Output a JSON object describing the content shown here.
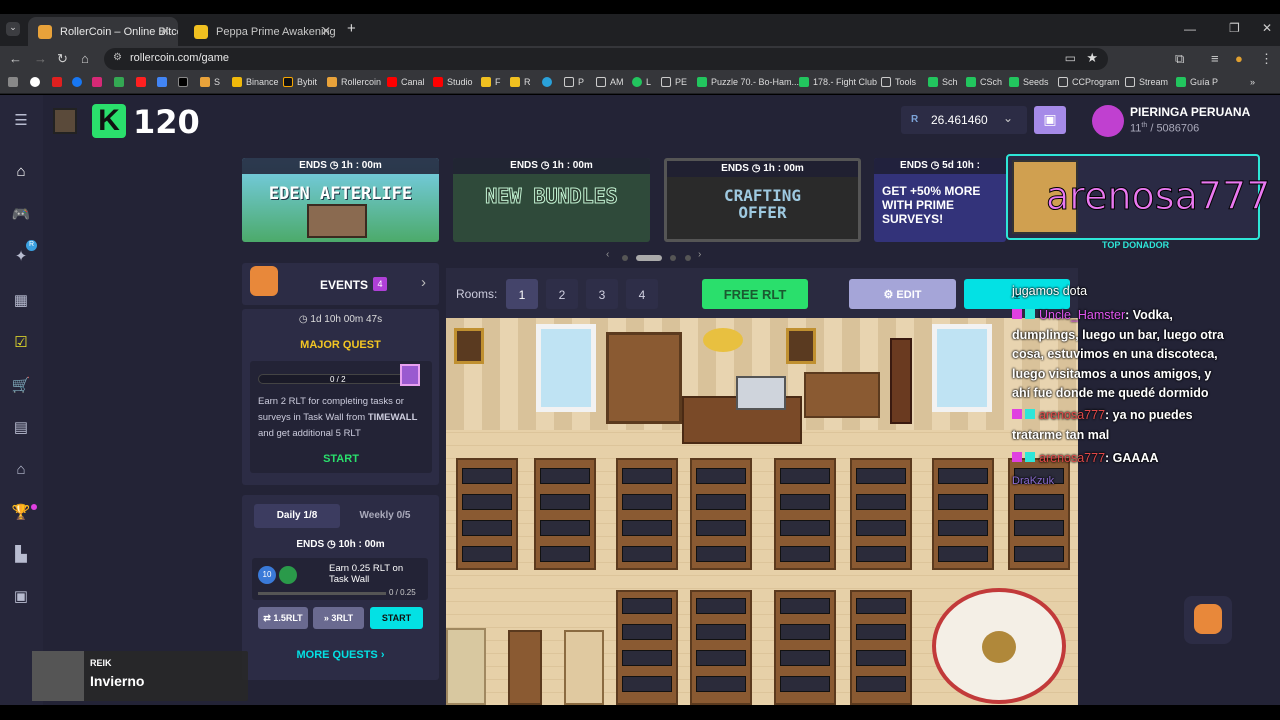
{
  "browser": {
    "tabs": [
      {
        "title": "RollerCoin – Online Bitcoin Min"
      },
      {
        "title": "Peppa Prime Awakening Event"
      }
    ],
    "new_tab": "+",
    "url": "rollercoin.com/game",
    "bookmarks": [
      "Binance",
      "Bybit",
      "Rollercoin",
      "Canal",
      "Studio",
      "F",
      "R",
      "P",
      "AM",
      "L",
      "PE",
      "Puzzle 70.- Bo-Ham...",
      "178.- Fight Club",
      "Tools",
      "Sch",
      "CSch",
      "Seeds",
      "CCProgram",
      "Stream",
      "Guía P",
      "S"
    ]
  },
  "header": {
    "level": "120",
    "balance": "26.461460",
    "balance_currency": "R",
    "username": "PIERINGA PERUANA",
    "rank": "11",
    "rank_suffix": "th",
    "rank_total": "/ 5086706"
  },
  "banners": [
    {
      "ends": "ENDS",
      "time": "1h : 00m",
      "title": "EDEN AFTERLIFE"
    },
    {
      "ends": "ENDS",
      "time": "1h : 00m",
      "title": "NEW BUNDLES"
    },
    {
      "ends": "ENDS",
      "time": "1h : 00m",
      "title": "CRAFTING OFFER"
    },
    {
      "ends": "ENDS",
      "time": "5d 10h :",
      "title": "GET +50% MORE WITH PRIME SURVEYS!"
    }
  ],
  "donor": {
    "name": "arenosa777",
    "label": "TOP DONADOR"
  },
  "events": {
    "title": "EVENTS",
    "count": "4",
    "timer": "1d 10h 00m 47s",
    "quest_title": "MAJOR QUEST",
    "progress": "0 / 2",
    "progress_fraction": 0,
    "description_1": "Earn 2 RLT for completing tasks or surveys in Task Wall from ",
    "description_strong": "TIMEWALL",
    "description_2": " and get additional 5 RLT",
    "start": "START"
  },
  "quests": {
    "daily": "Daily  1/8",
    "weekly": "Weekly  0/5",
    "ends": "ENDS",
    "ends_time": "10h : 00m",
    "task": "Earn 0.25 RLT on Task Wall",
    "task_progress": "0 / 0.25",
    "task_fraction": 0,
    "xp": "10",
    "btn1": "1.5RLT",
    "btn2": "3RLT",
    "start": "START",
    "more": "MORE QUESTS"
  },
  "rooms": {
    "label": "Rooms:",
    "numbers": [
      "1",
      "2",
      "3",
      "4"
    ],
    "free_rlt": "FREE RLT",
    "edit": "EDIT"
  },
  "chat": [
    {
      "user": "",
      "text": "jugamos dota"
    },
    {
      "user": "Uncle_Hamster",
      "text": ": Vodka, dumplings, luego un bar, luego otra cosa, estuvimos en una discoteca, luego visitamos a unos amigos, y ahí fue donde me quedé dormido"
    },
    {
      "user": "arenosa777",
      "text": ": ya no puedes tratarme tan mal"
    },
    {
      "user": "arenosa777",
      "text": ": GAAAA"
    },
    {
      "user": "DraKzuk",
      "text": ""
    }
  ],
  "music": {
    "artist": "REIK",
    "title": "Invierno"
  },
  "colors": {
    "accent_green": "#2adf6c",
    "accent_teal": "#03e1e4",
    "purple": "#a56bd9",
    "page_bg": "#232336",
    "sidebar_bg": "#26263a"
  }
}
